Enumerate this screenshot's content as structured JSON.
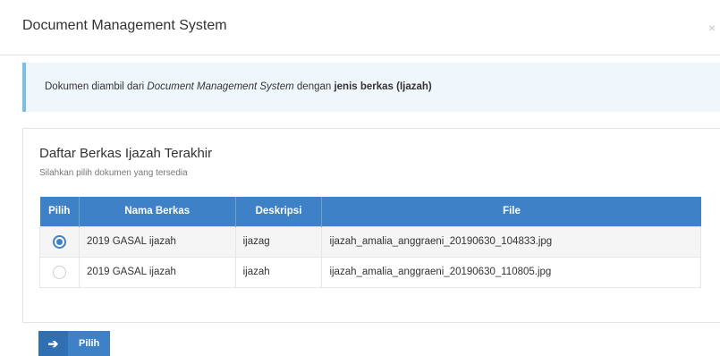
{
  "modal": {
    "title": "Document Management System",
    "close_symbol": "×"
  },
  "alert": {
    "prefix": "Dokumen diambil dari ",
    "emphasis": "Document Management System",
    "middle": " dengan ",
    "strong": "jenis berkas (Ijazah)"
  },
  "panel": {
    "title": "Daftar Berkas Ijazah Terakhir",
    "subtitle": "Silahkan pilih dokumen yang tersedia"
  },
  "table": {
    "headers": [
      "Pilih",
      "Nama Berkas",
      "Deskripsi",
      "File"
    ],
    "rows": [
      {
        "selected": true,
        "nama": "2019 GASAL ijazah",
        "deskripsi": "ijazag",
        "file": "ijazah_amalia_anggraeni_20190630_104833.jpg"
      },
      {
        "selected": false,
        "nama": "2019 GASAL ijazah",
        "deskripsi": "ijazah",
        "file": "ijazah_amalia_anggraeni_20190630_110805.jpg"
      }
    ]
  },
  "button": {
    "icon": "arrow-right-icon",
    "icon_glyph": "➔",
    "label": "Pilih"
  },
  "colors": {
    "accent": "#3f81c6",
    "alert_border": "#7bbde5",
    "alert_bg": "#f0f7fc"
  }
}
